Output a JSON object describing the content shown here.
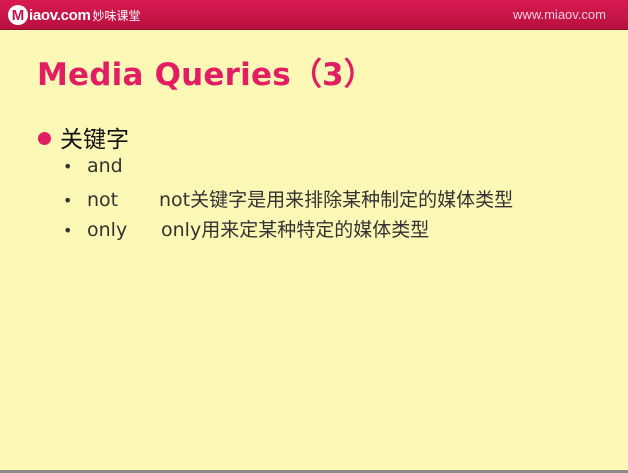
{
  "header": {
    "logo_letter": "M",
    "logo_text": "iaov.com",
    "logo_cn": "妙味课堂",
    "site_url": "www.miaov.com"
  },
  "slide": {
    "title": "Media Queries（3）",
    "bullet": "关键字",
    "items": [
      {
        "keyword": "and",
        "description": ""
      },
      {
        "keyword": "not",
        "description": "not关键字是用来排除某种制定的媒体类型"
      },
      {
        "keyword": "only",
        "description": "only用来定某种特定的媒体类型"
      }
    ]
  },
  "colors": {
    "background": "#fdf8b6",
    "accent": "#e21d63",
    "header_bar": "#c8134a"
  }
}
